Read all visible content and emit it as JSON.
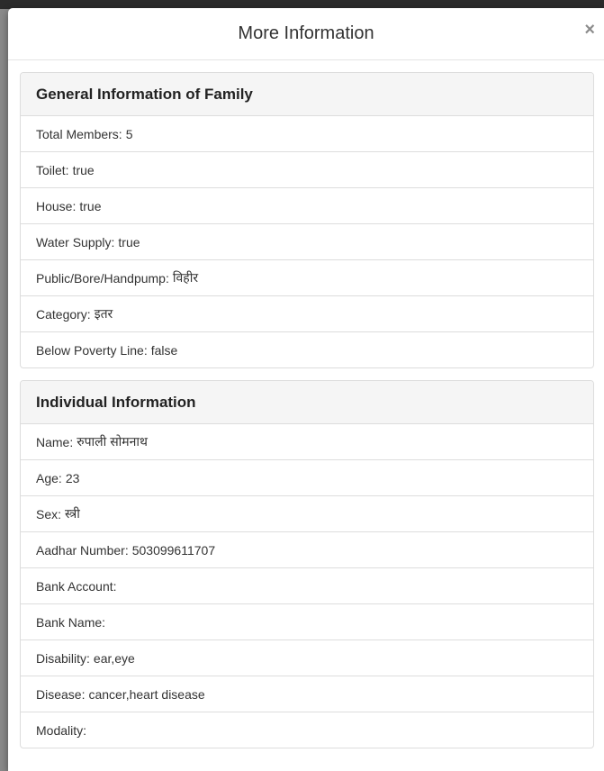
{
  "modal": {
    "title": "More Information",
    "close_label": "×"
  },
  "family": {
    "heading": "General Information of Family",
    "items": [
      {
        "label": "Total Members:",
        "value": "5"
      },
      {
        "label": "Toilet:",
        "value": "true"
      },
      {
        "label": "House:",
        "value": "true"
      },
      {
        "label": "Water Supply:",
        "value": "true"
      },
      {
        "label": "Public/Bore/Handpump:",
        "value": "विहीर"
      },
      {
        "label": "Category:",
        "value": "इतर"
      },
      {
        "label": "Below Poverty Line:",
        "value": "false"
      }
    ]
  },
  "individual": {
    "heading": "Individual Information",
    "items": [
      {
        "label": "Name:",
        "value": "रुपाली सोमनाथ"
      },
      {
        "label": "Age:",
        "value": "23"
      },
      {
        "label": "Sex:",
        "value": "स्त्री"
      },
      {
        "label": "Aadhar Number:",
        "value": "503099611707"
      },
      {
        "label": "Bank Account:",
        "value": ""
      },
      {
        "label": "Bank Name:",
        "value": ""
      },
      {
        "label": "Disability:",
        "value": "ear,eye"
      },
      {
        "label": "Disease:",
        "value": "cancer,heart disease"
      },
      {
        "label": "Modality:",
        "value": ""
      }
    ]
  }
}
